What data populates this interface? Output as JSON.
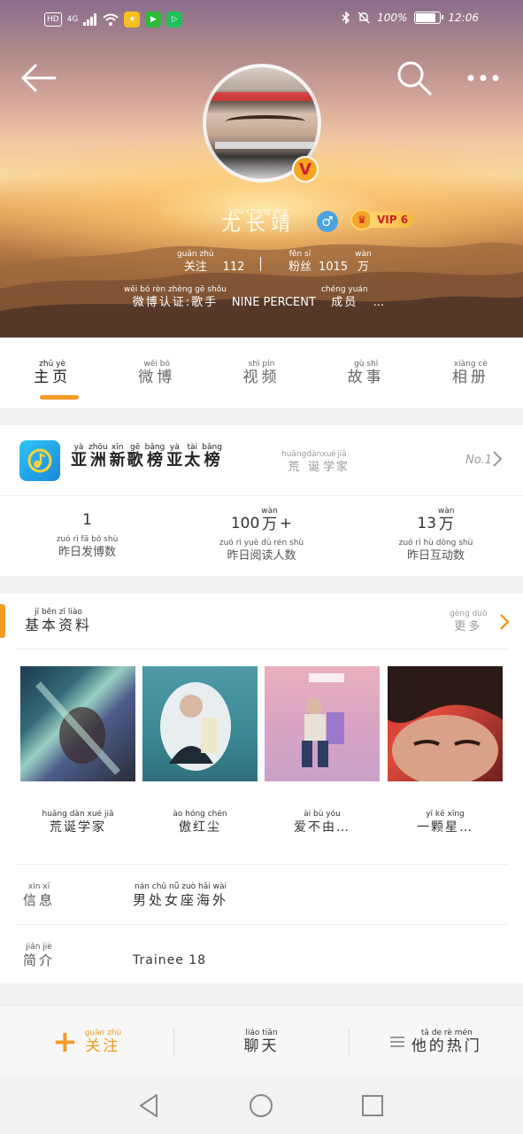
{
  "status_bar": {
    "left_items": [
      "HD",
      "4G"
    ],
    "battery_text": "100%",
    "time": "12:06"
  },
  "profile": {
    "username": {
      "hz": "尤长靖",
      "py": "yóu cháng jìng"
    },
    "vip_label": "VIP 6",
    "follow_label": {
      "hz": "关注",
      "py": "guān zhù"
    },
    "follow_count": "112",
    "fans_label": {
      "hz": "粉丝",
      "py": "fěn sī"
    },
    "fans_count": "1015",
    "fans_unit": {
      "hz": "万",
      "py": "wàn"
    },
    "verify_text_a": {
      "hz": "微博认证:歌手",
      "py": "wēi bó rèn zhèng gē shǒu"
    },
    "verify_text_b": "NINE PERCENT",
    "verify_text_c": {
      "hz": "成员",
      "py": "chéng yuán"
    },
    "verify_ellipsis": "..."
  },
  "tabs": [
    {
      "hz": "主页",
      "py": "zhǔ yè"
    },
    {
      "hz": "微博",
      "py": "wēi bó"
    },
    {
      "hz": "视频",
      "py": "shì pín"
    },
    {
      "hz": "故事",
      "py": "gù shì"
    },
    {
      "hz": "相册",
      "py": "xiàng cè"
    }
  ],
  "chart": {
    "title": [
      {
        "hz": "亚",
        "py": "yà"
      },
      {
        "hz": "洲",
        "py": "zhōu"
      },
      {
        "hz": "新",
        "py": "xīn"
      },
      {
        "hz": "歌",
        "py": "gē"
      },
      {
        "hz": "榜",
        "py": "bǎng"
      },
      {
        "hz": "亚",
        "py": "yà"
      },
      {
        "hz": "太",
        "py": "tài"
      },
      {
        "hz": "榜",
        "py": "bǎng"
      }
    ],
    "song": [
      {
        "hz": "荒",
        "py": "huāng"
      },
      {
        "hz": "诞",
        "py": "dàn"
      },
      {
        "hz": "学",
        "py": "xué"
      },
      {
        "hz": "家",
        "py": "jiā"
      }
    ],
    "rank": "No.1"
  },
  "stats": [
    {
      "value": "1",
      "unit": null,
      "label": {
        "hz": "昨日发博数",
        "py": "zuó rì fā bó shù"
      }
    },
    {
      "value": "100",
      "unit": {
        "hz": "万",
        "py": "wàn"
      },
      "suffix": "+",
      "label": {
        "hz": "昨日阅读人数",
        "py": "zuó rì yuè dú rén shù"
      }
    },
    {
      "value": "13",
      "unit": {
        "hz": "万",
        "py": "wàn"
      },
      "label": {
        "hz": "昨日互动数",
        "py": "zuó rì hù dòng shù"
      }
    }
  ],
  "info": {
    "title": {
      "hz": "基本资料",
      "py": "jī běn zī liào"
    },
    "more": {
      "hz": "更多",
      "py": "gèng duō"
    },
    "albums": [
      {
        "hz": "荒诞学家",
        "py": "huāng dàn xué jiā"
      },
      {
        "hz": "傲红尘",
        "py": "ào hóng chén"
      },
      {
        "hz": "爱不由…",
        "py": "ài bù yóu"
      },
      {
        "hz": "一颗星…",
        "py": "yī kē xīng"
      }
    ],
    "xinxi_key": {
      "hz": "信息",
      "py": "xìn xī"
    },
    "xinxi_val": {
      "hz": "男处女座海外",
      "py": "nán chǔ nǚ zuò hǎi wài"
    },
    "jianjie_key": {
      "hz": "简介",
      "py": "jiǎn jiè"
    },
    "jianjie_val": "Trainee 18"
  },
  "actions": {
    "follow": {
      "hz": "关注",
      "py": "guān zhù"
    },
    "chat": {
      "hz": "聊天",
      "py": "liáo tiān"
    },
    "hot": {
      "hz": "他的热门",
      "py": "tā de rè mén"
    }
  },
  "colors": {
    "accent": "#f59a23",
    "vip_red": "#c72222",
    "gender_blue": "#4aa3df"
  }
}
